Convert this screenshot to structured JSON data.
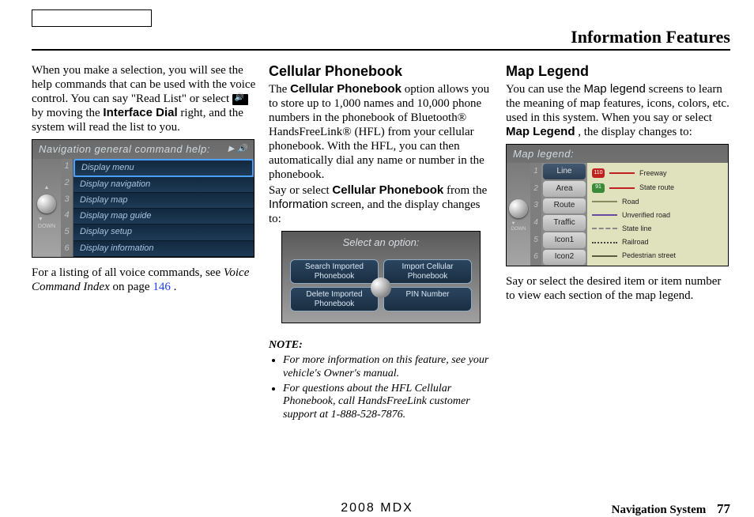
{
  "page_title": "Information Features",
  "footer": {
    "center": "2008  MDX",
    "right_label": "Navigation System",
    "page_number": "77"
  },
  "col1": {
    "para1_a": "When you make a selection, you will see the help commands that can be used with the voice control. You can say \"Read List\" or select ",
    "para1_b": " by moving the ",
    "interface_dial": "Interface Dial",
    "para1_c": " right, and the system will read the list to you.",
    "screenshot_title": "Navigation general command help:",
    "nav_items": [
      "Display menu",
      "Display navigation",
      "Display map",
      "Display map guide",
      "Display setup",
      "Display information"
    ],
    "para2_a": "For a listing of all voice commands, see ",
    "para2_link": "Voice Command Index",
    "para2_b": " on page ",
    "para2_page": "146",
    "para2_c": "."
  },
  "col2": {
    "heading": "Cellular Phonebook",
    "para1_a": "The ",
    "cp_bold": "Cellular Phonebook",
    "para1_b": " option allows you to store up to 1,000 names and 10,000 phone numbers in the phonebook of Bluetooth® HandsFreeLink® (HFL) from your cellular phonebook. With the HFL, you can then automatically dial any name or number in the phonebook.",
    "para2_a": "Say or select ",
    "cp_bold2": "Cellular Phonebook",
    "para2_b": " from the ",
    "info_word": "Information",
    "para2_c": " screen, and the display changes to:",
    "opt_title": "Select an option:",
    "opt_buttons": [
      "Search Imported Phonebook",
      "Import Cellular Phonebook",
      "Delete Imported Phonebook",
      "PIN Number"
    ],
    "note_title": "NOTE:",
    "note1": "For more information on this feature, see your vehicle's Owner's manual.",
    "note2": "For questions about the HFL Cellular Phonebook, call HandsFreeLink customer support at 1-888-528-7876."
  },
  "col3": {
    "heading": "Map Legend",
    "para1_a": "You can use the ",
    "ml_word": "Map legend",
    "para1_b": " screens to learn the meaning of map features, icons, colors, etc. used in this system. When you say or select ",
    "ml_bold": "Map Legend",
    "para1_c": ", the display changes to:",
    "map_title": "Map legend:",
    "map_tabs": [
      "Line",
      "Area",
      "Route",
      "Traffic",
      "Icon1",
      "Icon2"
    ],
    "legend_items": [
      {
        "label": "Freeway",
        "color": "#c02020",
        "shield": "110",
        "scolor": "#c02020"
      },
      {
        "label": "State route",
        "color": "#c02020",
        "shield": "91",
        "scolor": "#3a8a3a"
      },
      {
        "label": "Road",
        "color": "#8a8a60"
      },
      {
        "label": "Unverified road",
        "color": "#6a4aa0"
      },
      {
        "label": "State line",
        "dash": true
      },
      {
        "label": "Railroad",
        "dot": true
      },
      {
        "label": "Pedestrian street",
        "color": "#5a5a40"
      }
    ],
    "para2": "Say or select the desired item or item number to view each section of the map legend."
  }
}
